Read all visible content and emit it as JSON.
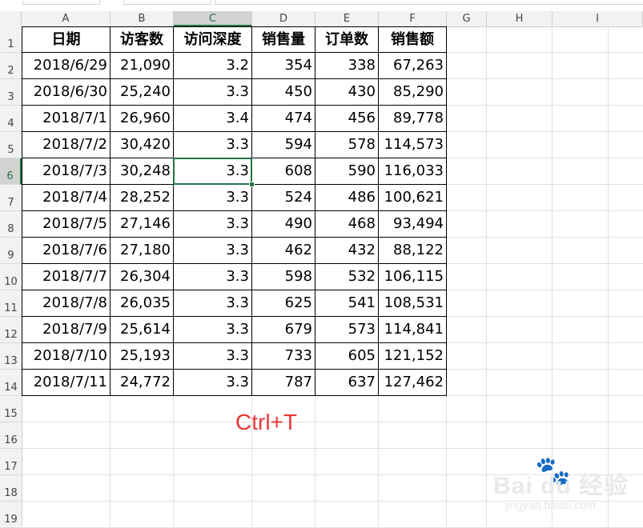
{
  "columns": [
    "A",
    "B",
    "C",
    "D",
    "E",
    "F",
    "G",
    "H",
    "I"
  ],
  "rows": [
    "1",
    "2",
    "3",
    "4",
    "5",
    "6",
    "7",
    "8",
    "9",
    "10",
    "11",
    "12",
    "13",
    "14",
    "15",
    "16",
    "17",
    "18",
    "19"
  ],
  "selected_cell": {
    "column": "C",
    "row": "6"
  },
  "table": {
    "headers": [
      "日期",
      "访客数",
      "访问深度",
      "销售量",
      "订单数",
      "销售额"
    ],
    "rows": [
      [
        "2018/6/29",
        "21,090",
        "3.2",
        "354",
        "338",
        "67,263"
      ],
      [
        "2018/6/30",
        "25,240",
        "3.3",
        "450",
        "430",
        "85,290"
      ],
      [
        "2018/7/1",
        "26,960",
        "3.4",
        "474",
        "456",
        "89,778"
      ],
      [
        "2018/7/2",
        "30,420",
        "3.3",
        "594",
        "578",
        "114,573"
      ],
      [
        "2018/7/3",
        "30,248",
        "3.3",
        "608",
        "590",
        "116,033"
      ],
      [
        "2018/7/4",
        "28,252",
        "3.3",
        "524",
        "486",
        "100,621"
      ],
      [
        "2018/7/5",
        "27,146",
        "3.3",
        "490",
        "468",
        "93,494"
      ],
      [
        "2018/7/6",
        "27,180",
        "3.3",
        "462",
        "432",
        "88,122"
      ],
      [
        "2018/7/7",
        "26,304",
        "3.3",
        "598",
        "532",
        "106,115"
      ],
      [
        "2018/7/8",
        "26,035",
        "3.3",
        "625",
        "541",
        "108,531"
      ],
      [
        "2018/7/9",
        "25,614",
        "3.3",
        "679",
        "573",
        "114,841"
      ],
      [
        "2018/7/10",
        "25,193",
        "3.3",
        "733",
        "605",
        "121,152"
      ],
      [
        "2018/7/11",
        "24,772",
        "3.3",
        "787",
        "637",
        "127,462"
      ]
    ]
  },
  "annotation": "Ctrl+T",
  "watermark": {
    "logo": "Bai du 经验",
    "url": "jingyan.baidu.com"
  },
  "colors": {
    "accent": "#217346",
    "annotation": "#e53935"
  }
}
